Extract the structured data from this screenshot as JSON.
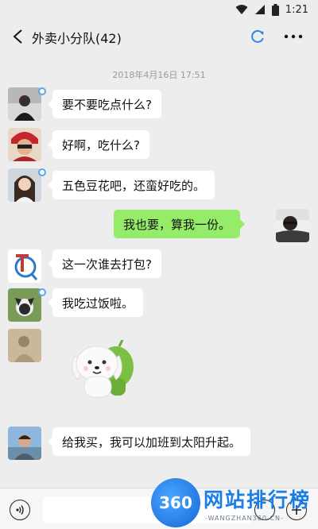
{
  "status_bar": {
    "time": "1:21"
  },
  "header": {
    "title": "外卖小分队(42)"
  },
  "chat": {
    "timestamp": "2018年4月16日 17:51",
    "messages": [
      {
        "direction": "in",
        "text": "要不要吃点什么?"
      },
      {
        "direction": "in",
        "text": "好啊，吃什么?"
      },
      {
        "direction": "in",
        "text": "五色豆花吧，还蛮好吃的。"
      },
      {
        "direction": "out",
        "text": "我也要，算我一份。"
      },
      {
        "direction": "in",
        "text": "这一次谁去打包?"
      },
      {
        "direction": "in",
        "text": "我吃过饭啦。"
      },
      {
        "direction": "in",
        "type": "sticker",
        "text": ""
      },
      {
        "direction": "in",
        "text": "给我买，我可以加班到太阳升起。"
      }
    ]
  },
  "input_bar": {
    "value": "",
    "placeholder": ""
  },
  "icons": {
    "back": "chevron-left-icon",
    "sync": "refresh-icon",
    "more": "more-icon",
    "voice": "voice-icon",
    "emoji": "emoji-icon",
    "plus": "plus-icon"
  },
  "watermark": {
    "logo_text": "360",
    "title": "网站排行榜",
    "url": "-WANGZHAN360.CN-"
  },
  "colors": {
    "background": "#ededed",
    "bubble_in": "#ffffff",
    "bubble_out": "#95ec69",
    "badge": "#5aa7e6"
  }
}
